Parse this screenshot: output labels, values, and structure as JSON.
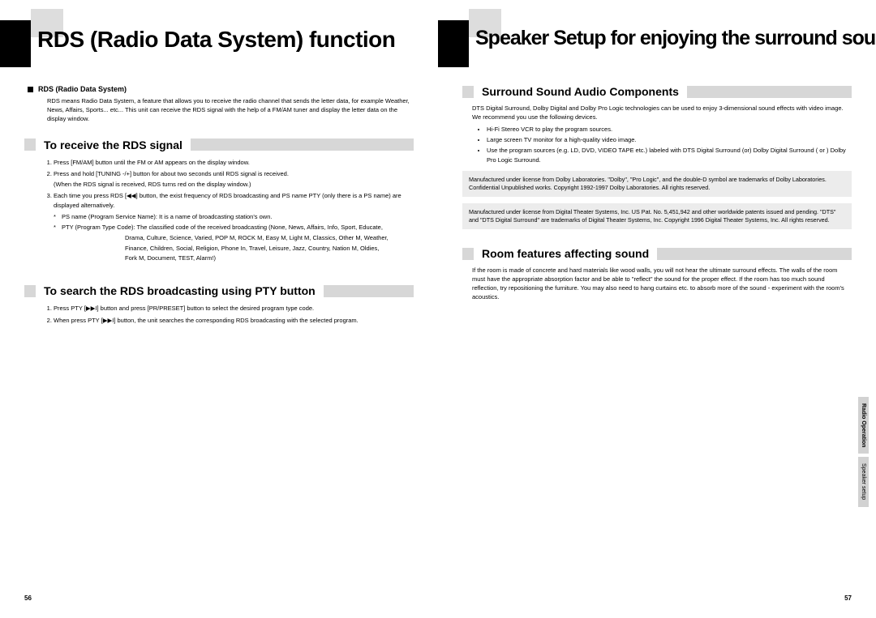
{
  "left": {
    "title": "RDS (Radio Data System) function",
    "rds_head": "RDS (Radio Data System)",
    "rds_body": "RDS means Radio Data System, a feature that allows you to receive the radio channel that sends the letter data,  for example Weather, News, Affairs, Sports... etc... This unit can receive the RDS signal with the help of a FM/AM tuner and display the letter data on the display window.",
    "sec1": "To receive the RDS signal",
    "steps1": [
      "Press [FM/AM] button until the FM or AM appears on the display window.",
      "Press and hold [TUNING -/+] button for about  two seconds until RDS signal is received.",
      "Each time you press RDS [◀◀] button, the exist frequency of RDS broadcasting  and PS name PTY (only there is a PS name) are displayed alternatively."
    ],
    "step2_sub": "(When the RDS signal is received, RDS turns red on the display window.)",
    "star1_label": "PS name (Program Service Name): It is a name of broadcasting station's own.",
    "star2_label": "PTY (Program Type Code): The classified code of the received broadcasting (None, News, Affairs, Info, Sport, Educate,",
    "star2_cont1": "Drama, Culture, Science, Varied, POP M, ROCK M, Easy M, Light M, Classics, Other M, Weather,",
    "star2_cont2": "Finance, Children, Social, Religion, Phone In, Travel, Leisure, Jazz, Country, Nation M, Oldies,",
    "star2_cont3": "Fork M, Document, TEST, Alarm!)",
    "sec2": "To search the RDS broadcasting using PTY button",
    "steps2": [
      "Press PTY [▶▶I] button and press [PR/PRESET] button to select the desired program type code.",
      "When press PTY [▶▶I] button, the unit searches the corresponding RDS broadcasting with the selected program."
    ],
    "pagenum": "56"
  },
  "right": {
    "title": "Speaker Setup for enjoying the surround sound effect",
    "sec1": "Surround Sound Audio Components",
    "p1": "DTS Digital Surround, Dolby Digital and Dolby Pro Logic technologies can be used to enjoy 3-dimensional sound effects with video image. We recommend you use the following devices.",
    "bullets": [
      "Hi-Fi Stereo VCR to play the program sources.",
      "Large screen TV monitor for a high-quality video image.",
      "Use the program sources (e.g. LD, DVD, VIDEO TAPE etc.) labeled with DTS Digital Surround (or) Dolby Digital Surround ( or ) Dolby Pro Logic Surround."
    ],
    "notice1": "Manufactured under license from Dolby Laboratories. \"Dolby\", \"Pro Logic\", and the double-D symbol are trademarks of Dolby Laboratories. Confidential Unpublished works. Copyright 1992-1997 Dolby Laboratories. All rights reserved.",
    "notice2": "Manufactured under license from Digital Theater Systems, Inc. US Pat. No. 5,451,942 and other worldwide patents issued and pending. \"DTS\" and \"DTS Digital Surround\" are trademarks of Digital Theater Systems, Inc. Copyright 1996 Digital Theater Systems, Inc. All rights reserved.",
    "sec2": "Room features affecting sound",
    "p2": "If the room is made of concrete and hard materials like wood walls, you will not hear the ultimate surround effects. The walls of the room must have the appropriate absorption factor and be able to \"reflect\" the sound for the proper effect. If the room has too much sound reflection, try repositioning the furniture. You may also need to hang curtains etc. to absorb more of the sound - experiment with the room's acoustics.",
    "tab1": "Radio Operation",
    "tab2": "Speaker setup",
    "pagenum": "57"
  }
}
